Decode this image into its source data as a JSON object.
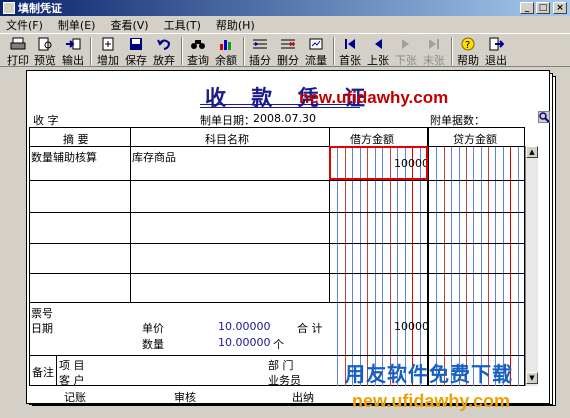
{
  "window": {
    "title": "填制凭证",
    "min_glyph": "_",
    "max_glyph": "□",
    "close_glyph": "×"
  },
  "menu": [
    {
      "label": "文件(F)"
    },
    {
      "label": "制单(E)"
    },
    {
      "label": "查看(V)"
    },
    {
      "label": "工具(T)"
    },
    {
      "label": "帮助(H)"
    }
  ],
  "toolbar": [
    {
      "label": "打印",
      "icon": "printer-icon"
    },
    {
      "label": "预览",
      "icon": "preview-icon"
    },
    {
      "label": "输出",
      "icon": "export-icon"
    },
    {
      "label": "增加",
      "icon": "add-icon"
    },
    {
      "label": "保存",
      "icon": "save-icon"
    },
    {
      "label": "放弃",
      "icon": "undo-icon"
    },
    {
      "label": "查询",
      "icon": "binoculars-icon"
    },
    {
      "label": "余额",
      "icon": "balance-icon"
    },
    {
      "label": "插分",
      "icon": "insert-row-icon"
    },
    {
      "label": "删分",
      "icon": "delete-row-icon"
    },
    {
      "label": "流量",
      "icon": "cashflow-icon"
    },
    {
      "label": "首张",
      "icon": "first-icon"
    },
    {
      "label": "上张",
      "icon": "prev-icon"
    },
    {
      "label": "下张",
      "icon": "next-icon"
    },
    {
      "label": "末张",
      "icon": "last-icon"
    },
    {
      "label": "帮助",
      "icon": "help-icon"
    },
    {
      "label": "退出",
      "icon": "exit-icon"
    }
  ],
  "voucher": {
    "title": "收 款 凭 证",
    "type_label": "收 字",
    "date_label": "制单日期：",
    "date": "2008.07.30",
    "attach_label": "附单据数：",
    "headers": {
      "summary": "摘 要",
      "account": "科目名称",
      "debit": "借方金额",
      "credit": "贷方金额"
    },
    "rows": [
      {
        "summary": "数量辅助核算",
        "account": "库存商品",
        "debit": "10000",
        "credit": ""
      },
      {
        "summary": "",
        "account": "",
        "debit": "",
        "credit": ""
      },
      {
        "summary": "",
        "account": "",
        "debit": "",
        "credit": ""
      },
      {
        "summary": "",
        "account": "",
        "debit": "",
        "credit": ""
      },
      {
        "summary": "",
        "account": "",
        "debit": "",
        "credit": ""
      }
    ],
    "footer": {
      "ticket_label": "票号",
      "date_label": "日期",
      "unit_price_label": "单价",
      "unit_price": "10.00000",
      "qty_label": "数量",
      "qty": "10.00000",
      "qty_unit": "个",
      "total_label": "合 计",
      "total_debit": "10000",
      "remark_label": "备注",
      "project_label": "项 目",
      "customer_label": "客 户",
      "dept_label": "部 门",
      "staff_label": "业务员"
    },
    "signatures": {
      "post": "记账",
      "audit": "审核",
      "cashier": "出纳"
    }
  },
  "watermarks": {
    "url_top": "new.ufidawhy.com",
    "cn_brand": "用友软件免费下载",
    "url_bottom": "new.ufidawhy.com"
  }
}
